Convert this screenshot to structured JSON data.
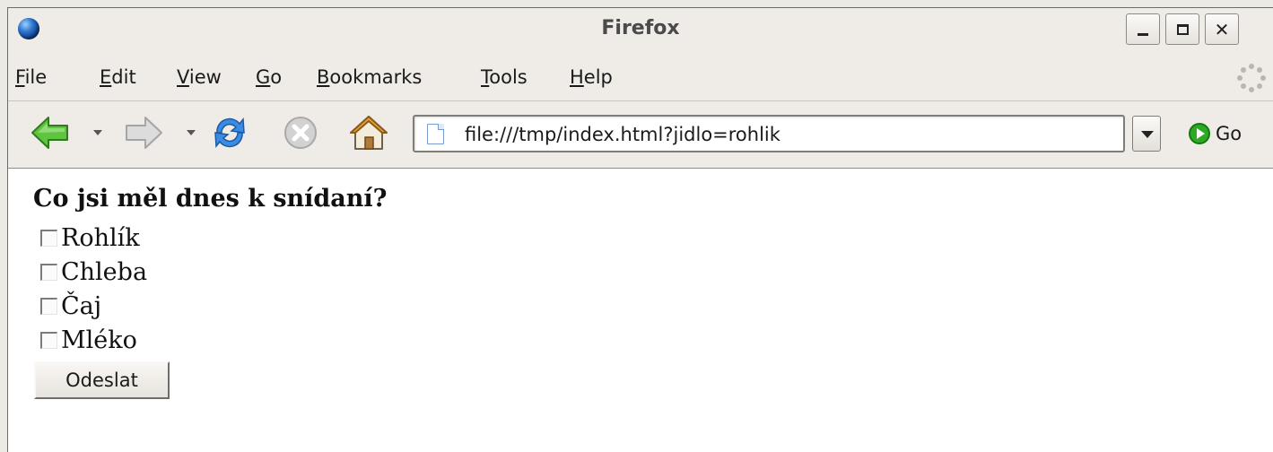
{
  "window": {
    "title": "Firefox",
    "controls": {
      "minimize": "minimize",
      "maximize": "maximize",
      "close": "✕"
    }
  },
  "menu": {
    "items": [
      {
        "accel": "F",
        "rest": "ile"
      },
      {
        "accel": "E",
        "rest": "dit"
      },
      {
        "accel": "V",
        "rest": "iew"
      },
      {
        "accel": "G",
        "rest": "o"
      },
      {
        "accel": "B",
        "rest": "ookmarks"
      },
      {
        "accel": "T",
        "rest": "ools"
      },
      {
        "accel": "H",
        "rest": "elp"
      }
    ]
  },
  "toolbar": {
    "address": "file:///tmp/index.html?jidlo=rohlik",
    "go_label": "Go",
    "icons": [
      "back-icon",
      "forward-icon",
      "reload-icon",
      "stop-icon",
      "home-icon",
      "page-icon",
      "go-icon"
    ]
  },
  "page": {
    "question": "Co jsi měl dnes k snídaní?",
    "options": [
      {
        "label": "Rohlík",
        "checked": false
      },
      {
        "label": "Chleba",
        "checked": false
      },
      {
        "label": "Čaj",
        "checked": false
      },
      {
        "label": "Mléko",
        "checked": false
      }
    ],
    "submit_label": "Odeslat"
  },
  "colors": {
    "chrome": "#efebe7",
    "content_bg": "#ffffff",
    "back_arrow": "#4cb832",
    "reload": "#2d7fd8"
  }
}
